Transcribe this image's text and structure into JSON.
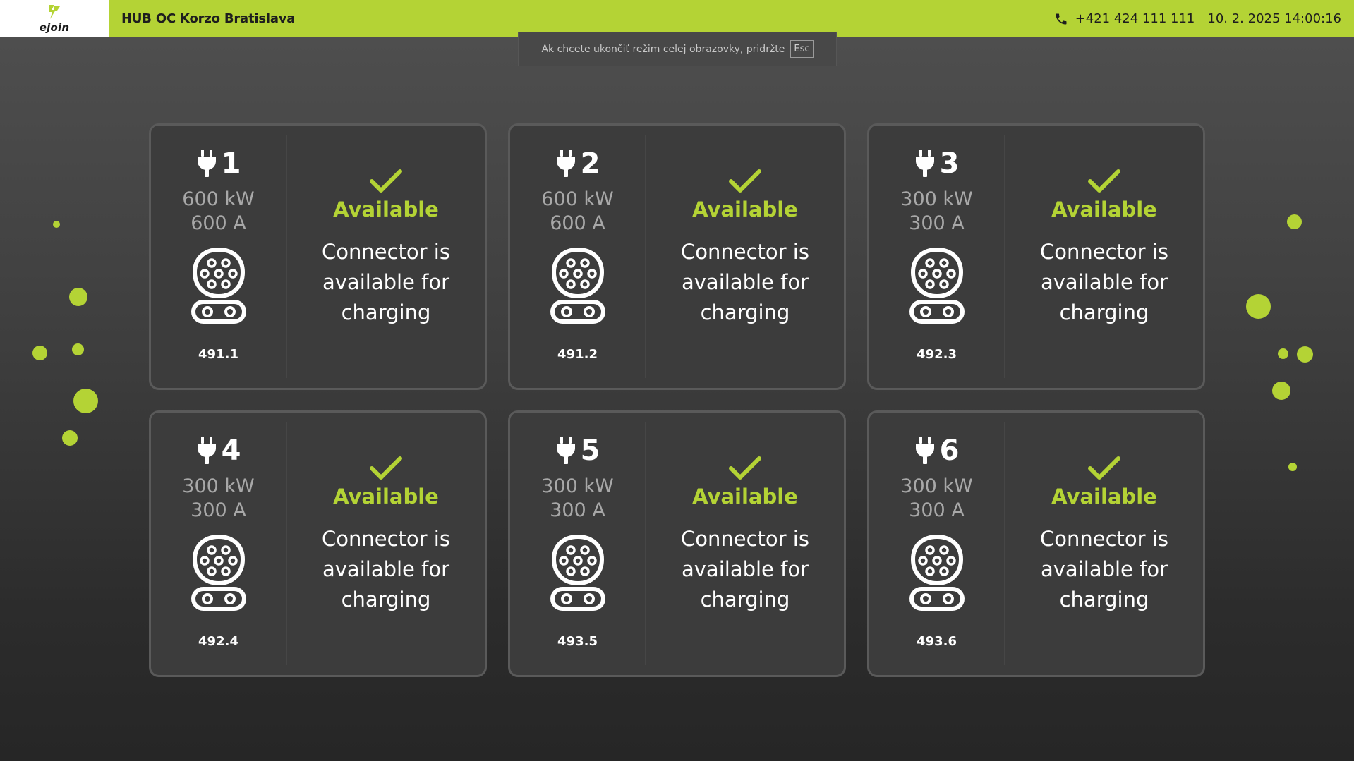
{
  "header": {
    "logo_text": "ejoin",
    "title": "HUB OC Korzo Bratislava",
    "phone_icon": "phone-icon",
    "phone": "+421 424 111 111",
    "datetime": "10. 2. 2025 14:00:16"
  },
  "toast": {
    "text": "Ak chcete ukončiť režim celej obrazovky, pridržte",
    "key": "Esc"
  },
  "colors": {
    "accent": "#b4d335",
    "card_bg": "#3c3c3c",
    "card_border": "#5a5a5a",
    "muted_text": "#a8a8a8"
  },
  "connectors": [
    {
      "number": "1",
      "power": "600 kW",
      "current": "600 A",
      "id": "491.1",
      "status": "Available",
      "description": "Connector is available for charging"
    },
    {
      "number": "2",
      "power": "600 kW",
      "current": "600 A",
      "id": "491.2",
      "status": "Available",
      "description": "Connector is available for charging"
    },
    {
      "number": "3",
      "power": "300 kW",
      "current": "300 A",
      "id": "492.3",
      "status": "Available",
      "description": "Connector is available for charging"
    },
    {
      "number": "4",
      "power": "300 kW",
      "current": "300 A",
      "id": "492.4",
      "status": "Available",
      "description": "Connector is available for charging"
    },
    {
      "number": "5",
      "power": "300 kW",
      "current": "300 A",
      "id": "493.5",
      "status": "Available",
      "description": "Connector is available for charging"
    },
    {
      "number": "6",
      "power": "300 kW",
      "current": "300 A",
      "id": "493.6",
      "status": "Available",
      "description": "Connector is available for charging"
    }
  ]
}
